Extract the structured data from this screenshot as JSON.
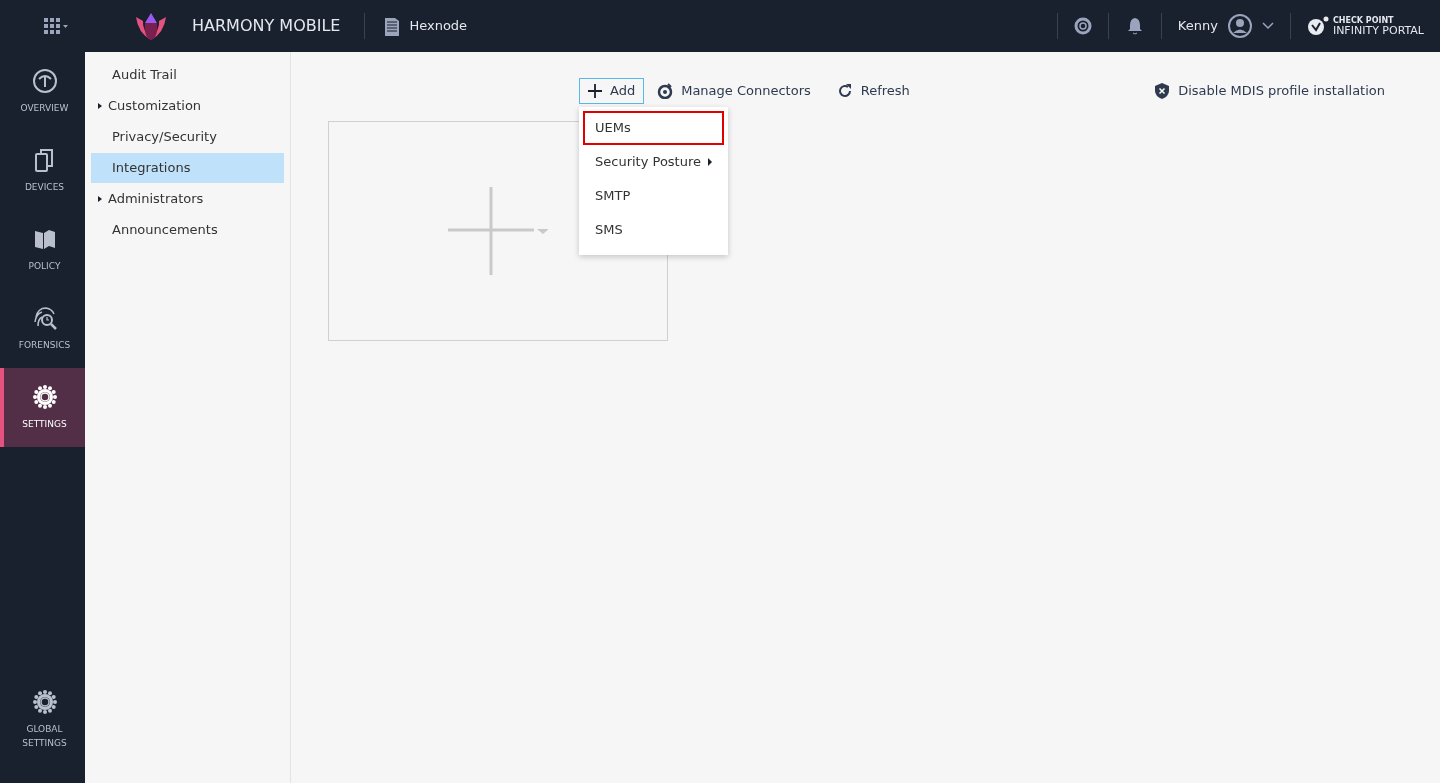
{
  "header": {
    "product": "HARMONY MOBILE",
    "tenant": "Hexnode",
    "user": "Kenny",
    "brand_top": "CHECK POINT",
    "brand_bottom": "INFINITY PORTAL"
  },
  "rail": [
    {
      "label": "OVERVIEW",
      "selected": false
    },
    {
      "label": "DEVICES",
      "selected": false
    },
    {
      "label": "POLICY",
      "selected": false
    },
    {
      "label": "FORENSICS",
      "selected": false
    },
    {
      "label": "SETTINGS",
      "selected": true
    }
  ],
  "rail_bottom": {
    "label": "GLOBAL SETTINGS"
  },
  "sidebar": {
    "items": [
      {
        "label": "Audit Trail",
        "expandable": false,
        "selected": false
      },
      {
        "label": "Customization",
        "expandable": true,
        "selected": false
      },
      {
        "label": "Privacy/Security",
        "expandable": false,
        "selected": false
      },
      {
        "label": "Integrations",
        "expandable": false,
        "selected": true
      },
      {
        "label": "Administrators",
        "expandable": true,
        "selected": false
      },
      {
        "label": "Announcements",
        "expandable": false,
        "selected": false
      }
    ]
  },
  "toolbar": {
    "add": "Add",
    "manage": "Manage Connectors",
    "refresh": "Refresh",
    "disable": "Disable MDIS profile installation"
  },
  "add_menu": [
    {
      "label": "UEMs",
      "highlighted": true,
      "submenu": false
    },
    {
      "label": "Security Posture",
      "highlighted": false,
      "submenu": true
    },
    {
      "label": "SMTP",
      "highlighted": false,
      "submenu": false
    },
    {
      "label": "SMS",
      "highlighted": false,
      "submenu": false
    }
  ]
}
